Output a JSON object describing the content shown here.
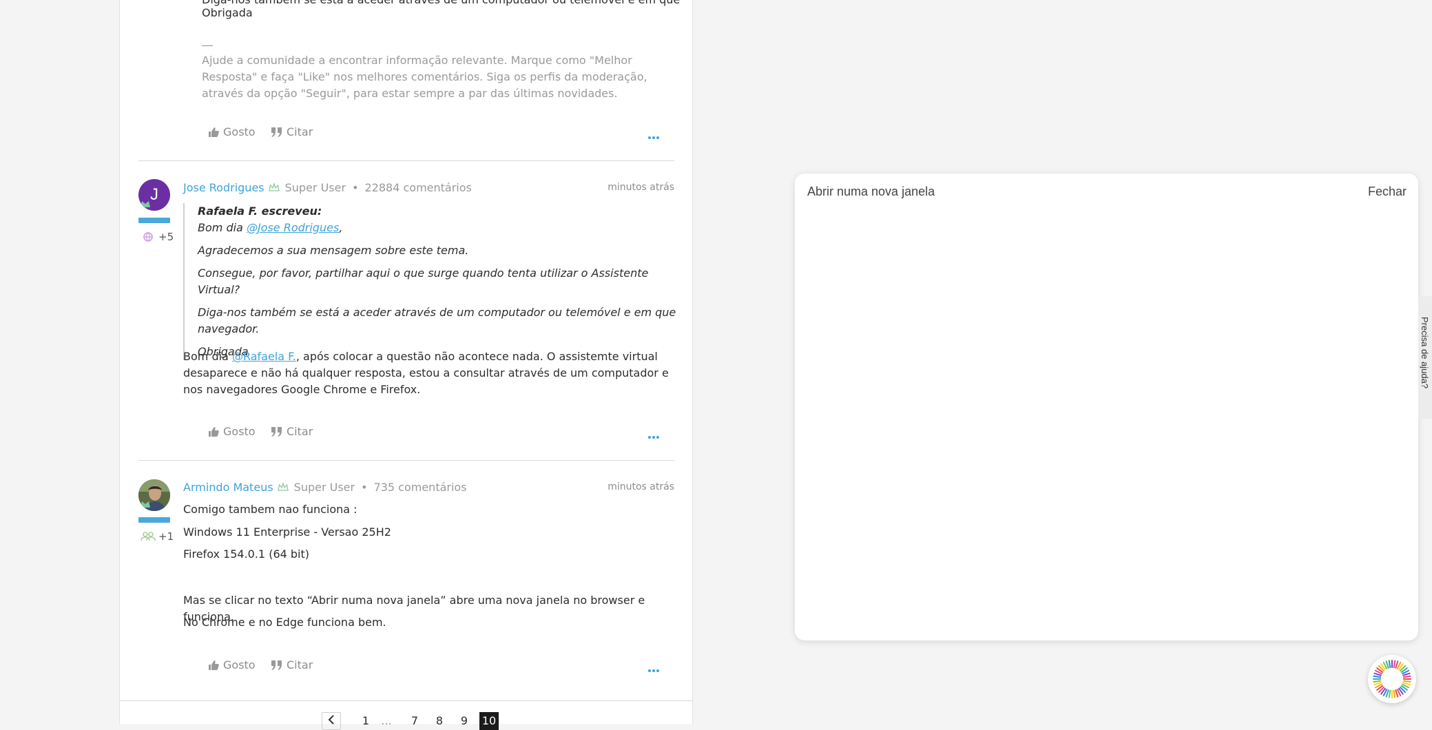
{
  "post1": {
    "partial_top_line": "Diga-nos também se está a aceder através de um computador ou telemóvel e em que navegador.",
    "closing": "Obrigada",
    "sig_dash": "__",
    "signature": "Ajude a comunidade a encontrar informação relevante. Marque como \"Melhor Resposta\" e faça \"Like\" nos melhores comentários. Siga os perfis da moderação, através da opção \"Seguir\", para estar sempre a par das últimas novidades.",
    "like_label": "Gosto",
    "quote_label": "Citar"
  },
  "post2": {
    "author": "Jose Rodrigues",
    "role": "Super User",
    "separator": "•",
    "comments": "22884 comentários",
    "time": "minutos atrás",
    "avatar_letter": "J",
    "kudos": "+5",
    "quote_author": "Rafaela F. escreveu:",
    "quote_greeting": "Bom dia ",
    "quote_mention": "@Jose Rodrigues",
    "quote_greeting_end": ",",
    "quote_lines": [
      "Agradecemos a sua mensagem sobre este tema.",
      "Consegue, por favor, partilhar aqui o que surge quando tenta utilizar o Assistente Virtual?",
      "Diga-nos também se está a aceder através de um computador ou telemóvel e em que navegador.",
      "Obrigada"
    ],
    "body_start": "Bom dia ",
    "body_mention": "@Rafaela F.",
    "body_rest": ", após colocar a questão não acontece nada. O assistemte virtual desaparece e não há qualquer resposta, estou a consultar através de um computador e nos navegadores Google Chrome e Firefox.",
    "like_label": "Gosto",
    "quote_label": "Citar"
  },
  "post3": {
    "author": "Armindo Mateus",
    "role": "Super User",
    "separator": "•",
    "comments": "735 comentários",
    "time": "minutos atrás",
    "kudos": "+1",
    "lines": [
      "Comigo tambem nao funciona :",
      "Windows 11 Enterprise - Versao 25H2",
      "Firefox 154.0.1 (64 bit)",
      "Mas se clicar no texto  “Abrir numa nova janela” abre uma nova janela no browser e funciona.",
      "No Chrome   e no Edge funciona bem."
    ],
    "like_label": "Gosto",
    "quote_label": "Citar"
  },
  "pagination": {
    "pages": [
      "1",
      "7",
      "8",
      "9",
      "10"
    ],
    "current": "10",
    "ellipsis": "..."
  },
  "modal": {
    "title": "Abrir numa nova janela",
    "close": "Fechar"
  },
  "help_tab": {
    "label": "Precisa de ajuda?"
  },
  "colors": {
    "accent": "#3fa3d8",
    "avatar_purple": "#6b2fa3",
    "background": "#f4f4f4"
  }
}
